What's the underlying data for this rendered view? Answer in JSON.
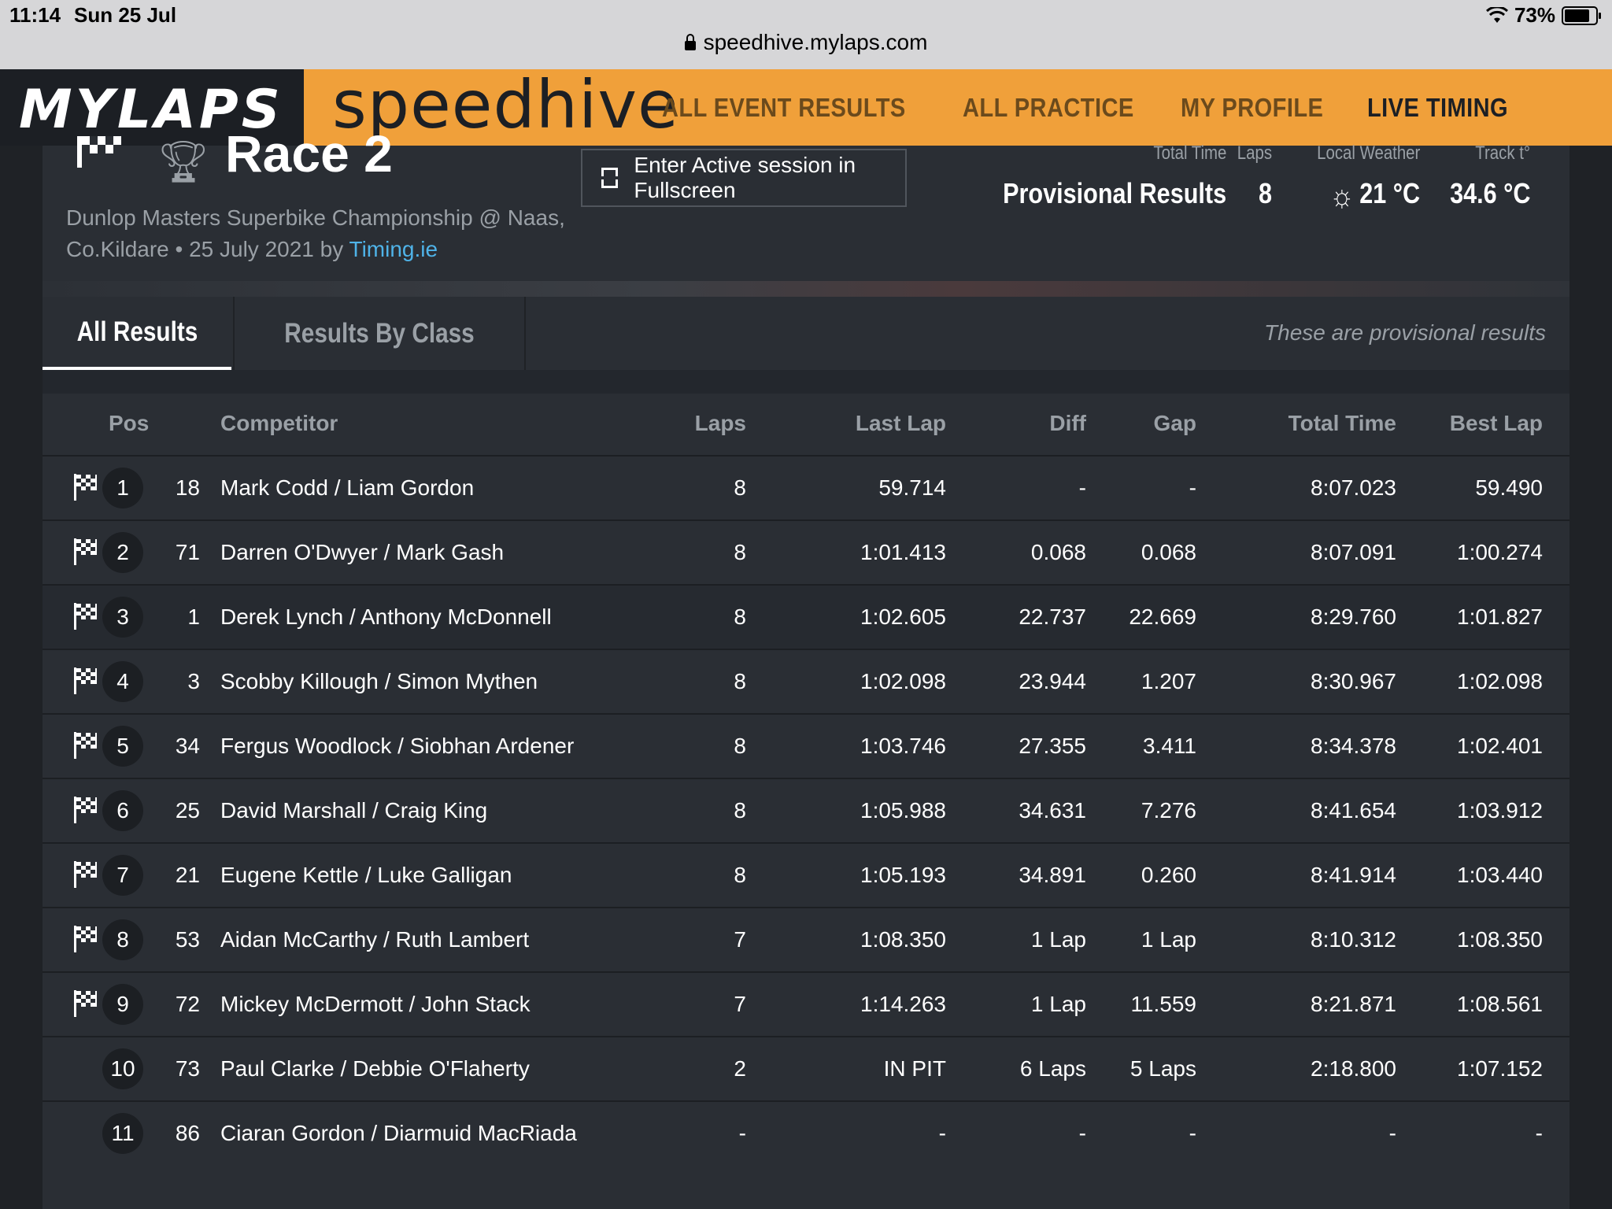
{
  "statusbar": {
    "time": "11:14",
    "date": "Sun 25 Jul",
    "battery": "73%",
    "battery_level": 0.73
  },
  "browser": {
    "url": "speedhive.mylaps.com"
  },
  "header": {
    "logo": "MYLAPS",
    "brand": "speedhive",
    "nav": [
      "ALL EVENT RESULTS",
      "ALL PRACTICE",
      "MY PROFILE",
      "LIVE TIMING"
    ],
    "active_nav": "LIVE TIMING"
  },
  "session": {
    "title": "Race 2",
    "subtitle_line1": "Dunlop Masters Superbike Championship @ Naas,",
    "subtitle_line2": "Co.Kildare • 25 July 2021 by ",
    "organizer": "Timing.ie",
    "fullscreen_label": "Enter Active session in Fullscreen",
    "stats": {
      "total_time_label": "Total Time",
      "total_time_value": "Provisional Results",
      "laps_label": "Laps",
      "laps_value": "8",
      "weather_label": "Local Weather",
      "weather_value": "21 °C",
      "track_label": "Track t°",
      "track_value": "34.6 °C"
    }
  },
  "tabs": {
    "all_results": "All Results",
    "by_class": "Results By Class",
    "note": "These are provisional results"
  },
  "table": {
    "headers": {
      "pos": "Pos",
      "competitor": "Competitor",
      "laps": "Laps",
      "last_lap": "Last Lap",
      "diff": "Diff",
      "gap": "Gap",
      "total_time": "Total Time",
      "best_lap": "Best Lap"
    },
    "rows": [
      {
        "pos": "1",
        "no": "18",
        "name": "Mark Codd / Liam Gordon",
        "laps": "8",
        "last": "59.714",
        "diff": "-",
        "gap": "-",
        "total": "8:07.023",
        "best": "59.490",
        "flag": true
      },
      {
        "pos": "2",
        "no": "71",
        "name": "Darren O'Dwyer / Mark Gash",
        "laps": "8",
        "last": "1:01.413",
        "diff": "0.068",
        "gap": "0.068",
        "total": "8:07.091",
        "best": "1:00.274",
        "flag": true
      },
      {
        "pos": "3",
        "no": "1",
        "name": "Derek Lynch / Anthony McDonnell",
        "laps": "8",
        "last": "1:02.605",
        "diff": "22.737",
        "gap": "22.669",
        "total": "8:29.760",
        "best": "1:01.827",
        "flag": true
      },
      {
        "pos": "4",
        "no": "3",
        "name": "Scobby Killough / Simon Mythen",
        "laps": "8",
        "last": "1:02.098",
        "diff": "23.944",
        "gap": "1.207",
        "total": "8:30.967",
        "best": "1:02.098",
        "flag": true
      },
      {
        "pos": "5",
        "no": "34",
        "name": "Fergus Woodlock / Siobhan Ardener",
        "laps": "8",
        "last": "1:03.746",
        "diff": "27.355",
        "gap": "3.411",
        "total": "8:34.378",
        "best": "1:02.401",
        "flag": true
      },
      {
        "pos": "6",
        "no": "25",
        "name": "David Marshall / Craig King",
        "laps": "8",
        "last": "1:05.988",
        "diff": "34.631",
        "gap": "7.276",
        "total": "8:41.654",
        "best": "1:03.912",
        "flag": true
      },
      {
        "pos": "7",
        "no": "21",
        "name": "Eugene Kettle / Luke Galligan",
        "laps": "8",
        "last": "1:05.193",
        "diff": "34.891",
        "gap": "0.260",
        "total": "8:41.914",
        "best": "1:03.440",
        "flag": true
      },
      {
        "pos": "8",
        "no": "53",
        "name": "Aidan McCarthy / Ruth Lambert",
        "laps": "7",
        "last": "1:08.350",
        "diff": "1 Lap",
        "gap": "1 Lap",
        "total": "8:10.312",
        "best": "1:08.350",
        "flag": true
      },
      {
        "pos": "9",
        "no": "72",
        "name": "Mickey McDermott / John Stack",
        "laps": "7",
        "last": "1:14.263",
        "diff": "1 Lap",
        "gap": "11.559",
        "total": "8:21.871",
        "best": "1:08.561",
        "flag": true
      },
      {
        "pos": "10",
        "no": "73",
        "name": "Paul Clarke / Debbie O'Flaherty",
        "laps": "2",
        "last": "IN PIT",
        "diff": "6 Laps",
        "gap": "5 Laps",
        "total": "2:18.800",
        "best": "1:07.152",
        "flag": false
      },
      {
        "pos": "11",
        "no": "86",
        "name": "Ciaran Gordon / Diarmuid MacRiada",
        "laps": "-",
        "last": "-",
        "diff": "-",
        "gap": "-",
        "total": "-",
        "best": "-",
        "flag": false
      }
    ]
  },
  "icons": {
    "flag": "checkered-flag-icon",
    "trophy": "trophy-icon",
    "sun": "sun-icon",
    "lock": "lock-icon",
    "wifi": "wifi-icon",
    "fullscreen": "fullscreen-icon"
  },
  "colors": {
    "brand_orange": "#f0a03a",
    "background": "#23272d",
    "link": "#4fb3e8"
  }
}
